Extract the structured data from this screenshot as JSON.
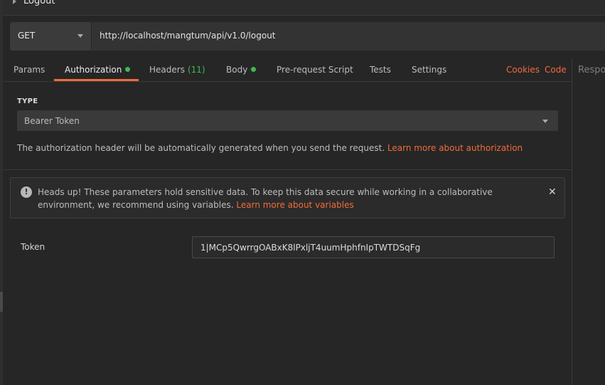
{
  "top": {
    "title": "Logout"
  },
  "request": {
    "method": "GET",
    "url": "http://localhost/mangtum/api/v1.0/logout"
  },
  "tabs": [
    {
      "label": "Params"
    },
    {
      "label": "Authorization"
    },
    {
      "label": "Headers",
      "count": "(11)"
    },
    {
      "label": "Body"
    },
    {
      "label": "Pre-request Script"
    },
    {
      "label": "Tests"
    },
    {
      "label": "Settings"
    }
  ],
  "links": {
    "cookies": "Cookies",
    "code": "Code"
  },
  "auth": {
    "type_label": "TYPE",
    "type_value": "Bearer Token",
    "help_text": "The authorization header will be automatically generated when you send the request.",
    "help_link": "Learn more about authorization"
  },
  "alert": {
    "text": "Heads up! These parameters hold sensitive data. To keep this data secure while working in a collaborative environment, we recommend using variables.",
    "link": "Learn more about variables",
    "close": "✕"
  },
  "token": {
    "label": "Token",
    "value": "1|MCp5QwrrgOABxK8lPxljT4uumHphfnIpTWTDSqFg"
  },
  "response": {
    "label": "Respo"
  },
  "colors": {
    "accent": "#f26b3a",
    "status_dot": "#3fb950"
  }
}
